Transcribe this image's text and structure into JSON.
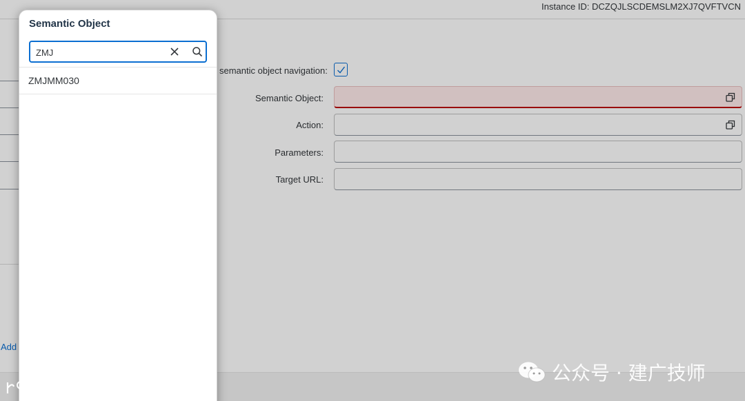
{
  "header": {
    "instance_id": "Instance ID: DCZQJLSCDEMSLM2XJ7QVFTVCN"
  },
  "form": {
    "nav_label": "semantic object navigation:",
    "nav_checked": true,
    "semantic_object_label": "Semantic Object:",
    "semantic_object_value": "",
    "action_label": "Action:",
    "action_value": "",
    "parameters_label": "Parameters:",
    "parameters_value": "",
    "target_url_label": "Target URL:",
    "target_url_value": ""
  },
  "left_panel": {
    "add_link": "Add"
  },
  "popover": {
    "title": "Semantic Object",
    "search_value": "ZMJ",
    "results": [
      "ZMJMM030"
    ]
  },
  "watermark": {
    "right_text": "公众号 · 建广技师",
    "left_text": "大数跨境"
  },
  "colors": {
    "accent": "#0a6ed1",
    "error_border": "#bb0000",
    "error_bg": "#ffebeb"
  },
  "icons": {
    "value_help": "value-help-icon",
    "clear": "clear-icon",
    "search": "search-icon",
    "check": "check-icon"
  }
}
